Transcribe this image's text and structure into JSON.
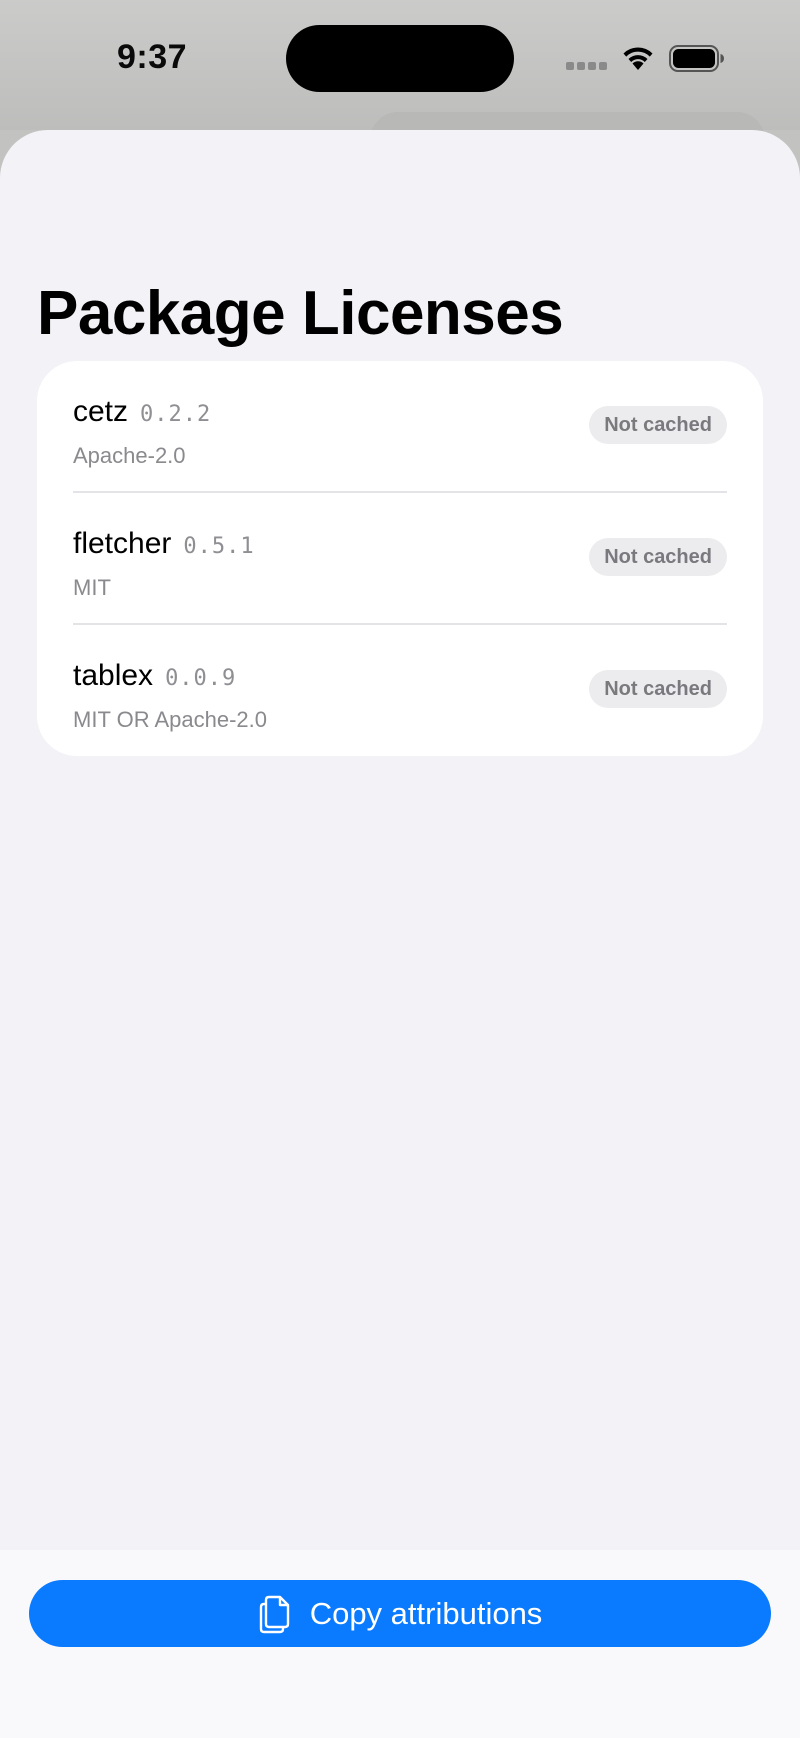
{
  "status_bar": {
    "time": "9:37"
  },
  "page": {
    "title": "Package Licenses"
  },
  "packages": [
    {
      "name": "cetz",
      "version": "0.2.2",
      "license": "Apache-2.0",
      "status": "Not cached"
    },
    {
      "name": "fletcher",
      "version": "0.5.1",
      "license": "MIT",
      "status": "Not cached"
    },
    {
      "name": "tablex",
      "version": "0.0.9",
      "license": "MIT OR Apache-2.0",
      "status": "Not cached"
    }
  ],
  "toolbar": {
    "copy_label": "Copy attributions",
    "copy_icon": "doc-on-doc-icon"
  },
  "colors": {
    "accent": "#0a7aff",
    "background": "#f2f2f7",
    "card": "#ffffff",
    "secondary_text": "#8a8a8e"
  }
}
